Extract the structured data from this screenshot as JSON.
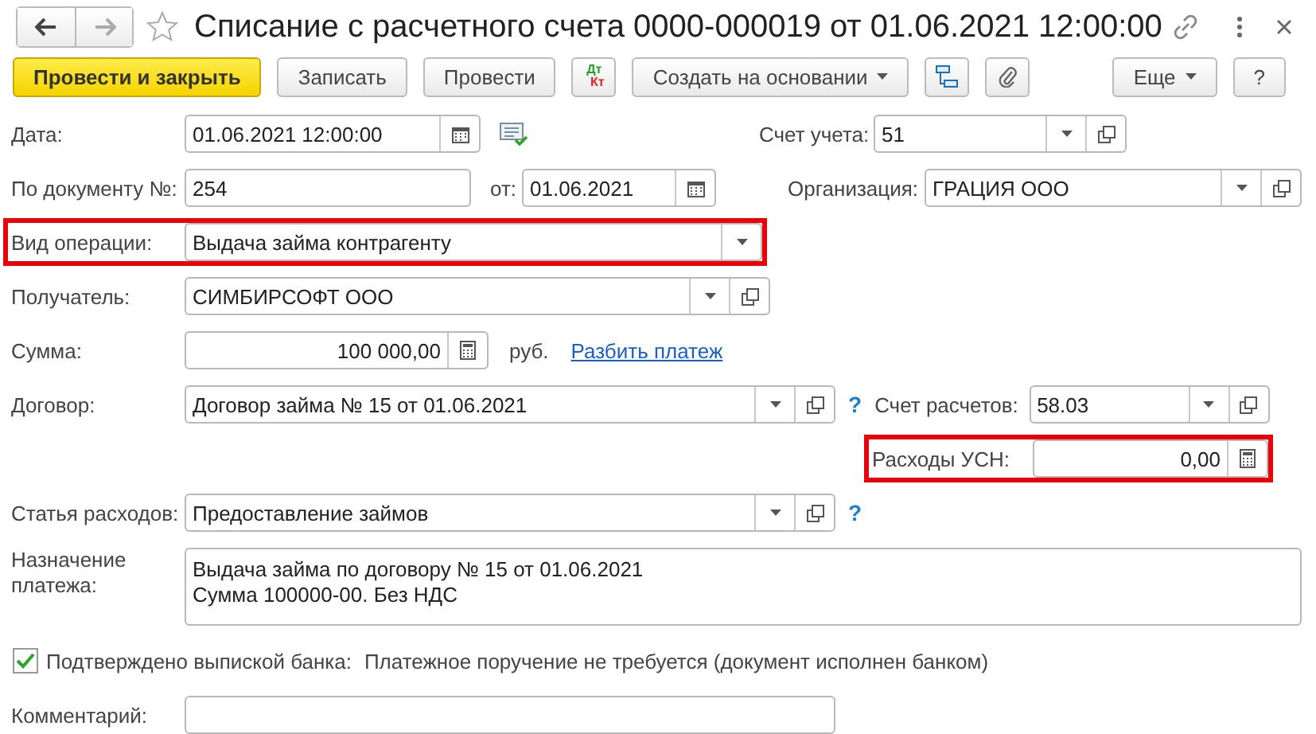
{
  "window": {
    "title": "Списание с расчетного счета 0000-000019 от 01.06.2021 12:00:00"
  },
  "toolbar": {
    "left": [
      {
        "kind": "primary",
        "label": "Провести и закрыть"
      },
      {
        "kind": "button",
        "label": "Записать"
      },
      {
        "kind": "button",
        "label": "Провести"
      },
      {
        "kind": "dtkt",
        "debit": "Дт",
        "credit": "Кт"
      },
      {
        "kind": "menu",
        "label": "Создать на основании"
      },
      {
        "kind": "structure"
      },
      {
        "kind": "clip"
      }
    ],
    "right": [
      {
        "kind": "menu",
        "label": "Еще"
      },
      {
        "kind": "button",
        "label": "?"
      }
    ]
  },
  "form": {
    "date": {
      "label": "Дата:",
      "value": "01.06.2021 12:00:00"
    },
    "account": {
      "label": "Счет учета:",
      "value": "51"
    },
    "doc_number": {
      "label": "По документу №:",
      "value": "254"
    },
    "doc_date": {
      "label": "от:",
      "value": "01.06.2021"
    },
    "organization": {
      "label": "Организация:",
      "value": "ГРАЦИЯ ООО"
    },
    "operation": {
      "label": "Вид операции:",
      "value": "Выдача займа контрагенту",
      "highlighted": true
    },
    "recipient": {
      "label": "Получатель:",
      "value": "СИМБИРСОФТ ООО"
    },
    "amount": {
      "label": "Сумма:",
      "value": "100 000,00",
      "currency": "руб.",
      "link": "Разбить платеж"
    },
    "contract": {
      "label": "Договор:",
      "value": "Договор займа № 15 от 01.06.2021",
      "help": "?"
    },
    "settlement_account": {
      "label": "Счет расчетов:",
      "value": "58.03"
    },
    "usn_expenses": {
      "label": "Расходы УСН:",
      "value": "0,00",
      "highlighted": true
    },
    "expense_item": {
      "label": "Статья расходов:",
      "value": "Предоставление займов",
      "help": "?"
    },
    "purpose": {
      "label": "Назначение платежа:",
      "lines": [
        "Выдача займа по договору № 15 от 01.06.2021",
        "Сумма 100000-00. Без НДС"
      ]
    },
    "bank_confirmed": {
      "label": "Подтверждено выпиской банка:",
      "checked": true,
      "note": "Платежное поручение не требуется (документ исполнен банком)"
    },
    "comment": {
      "label": "Комментарий:"
    }
  }
}
